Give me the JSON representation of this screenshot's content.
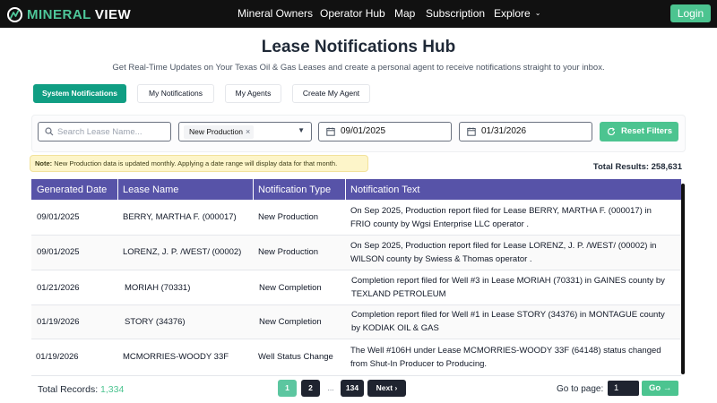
{
  "brand": {
    "part1": "MINERAL",
    "part2": "VIEW"
  },
  "nav": {
    "items": [
      "Mineral Owners",
      "Operator Hub",
      "Map",
      "Subscription",
      "Explore"
    ],
    "login": "Login"
  },
  "header": {
    "title": "Lease Notifications Hub",
    "subtitle": "Get Real-Time Updates on Your Texas Oil & Gas Leases and create a personal agent to receive notifications straight to your inbox."
  },
  "tabs": [
    "System Notifications",
    "My Notifications",
    "My Agents",
    "Create My Agent"
  ],
  "filters": {
    "search_placeholder": "Search Lease Name...",
    "type_selected": "New Production",
    "date_from": "09/01/2025",
    "date_to": "01/31/2026",
    "reset_label": "Reset Filters"
  },
  "note": {
    "label": "Note:",
    "text": "New Production data is updated monthly. Applying a date range will display data for that month."
  },
  "total_results": "Total Results: 258,631",
  "table": {
    "columns": [
      "Generated Date",
      "Lease Name",
      "Notification Type",
      "Notification Text"
    ],
    "rows": [
      {
        "date": "09/01/2025",
        "lease": "BERRY, MARTHA F. (000017)",
        "type": "New Production",
        "text": "On Sep 2025, Production report filed for Lease BERRY, MARTHA F. (000017) in FRIO county by Wgsi Enterprise LLC operator ."
      },
      {
        "date": "09/01/2025",
        "lease": "LORENZ, J. P. /WEST/ (00002)",
        "type": "New Production",
        "text": "On Sep 2025, Production report filed for Lease LORENZ, J. P. /WEST/ (00002) in WILSON county by Swiess & Thomas operator ."
      },
      {
        "date": "01/21/2026",
        "lease": "MORIAH (70331)",
        "type": "New Completion",
        "text": "Completion report filed for Well #3 in Lease MORIAH (70331) in GAINES county by TEXLAND PETROLEUM"
      },
      {
        "date": "01/19/2026",
        "lease": "STORY (34376)",
        "type": "New Completion",
        "text": "Completion report filed for Well #1 in Lease STORY (34376) in MONTAGUE county by KODIAK OIL & GAS"
      },
      {
        "date": "01/19/2026",
        "lease": "MCMORRIES-WOODY 33F",
        "type": "Well Status Change",
        "text": "The Well #106H under Lease MCMORRIES-WOODY 33F (64148) status changed from Shut-In Producer to Producing."
      }
    ]
  },
  "footer": {
    "total_label": "Total Records:",
    "total_value": "1,334",
    "pages": [
      "1",
      "2",
      "...",
      "134"
    ],
    "next": "Next",
    "goto_label": "Go to page:",
    "goto_value": "1",
    "go": "Go"
  }
}
